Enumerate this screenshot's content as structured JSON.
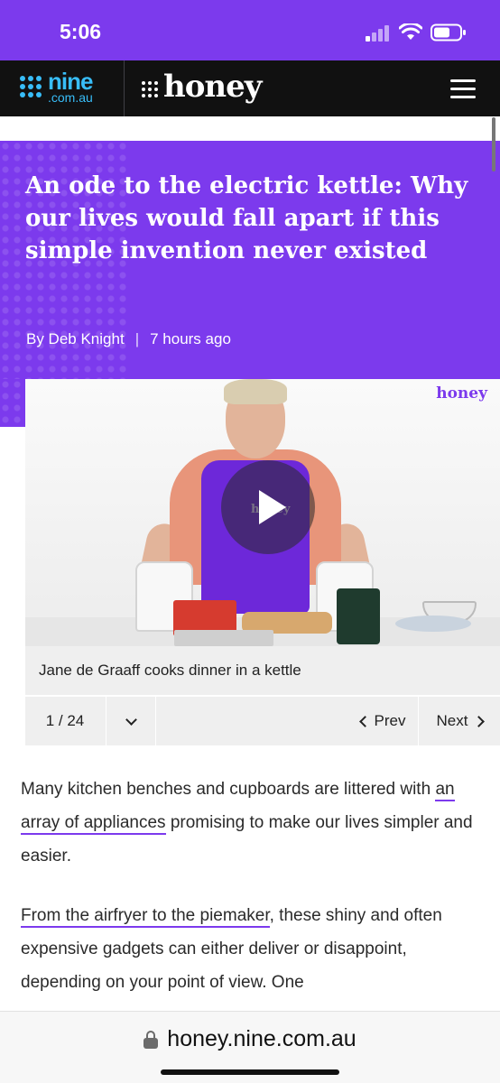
{
  "status_bar": {
    "time": "5:06"
  },
  "nav": {
    "nine_logo_text": "nine",
    "nine_logo_sub": ".com.au",
    "honey_logo_text": "honey"
  },
  "article": {
    "headline": "An ode to the electric kettle: Why our lives would fall apart if this simple invention never existed",
    "byline": {
      "author": "By Deb Knight",
      "separator": "|",
      "time": "7 hours ago"
    },
    "video": {
      "watermark": "honey",
      "apron_text": "honey",
      "caption": "Jane de Graaff cooks dinner in a kettle"
    },
    "gallery": {
      "counter": "1 / 24",
      "prev_label": "Prev",
      "next_label": "Next"
    },
    "paragraphs": [
      {
        "before": "Many kitchen benches and cupboards are littered with ",
        "link": "an array of appliances",
        "after": " promising to make our lives simpler and easier."
      },
      {
        "before": "",
        "link": "From the airfryer to the piemaker",
        "after": ", these shiny and often expensive gadgets can either deliver or disappoint, depending on your point of view. One"
      }
    ]
  },
  "browser": {
    "url": "honey.nine.com.au"
  },
  "colors": {
    "brand_purple": "#7c3aed",
    "nav_black": "#111111",
    "nine_blue": "#38bdf8"
  }
}
